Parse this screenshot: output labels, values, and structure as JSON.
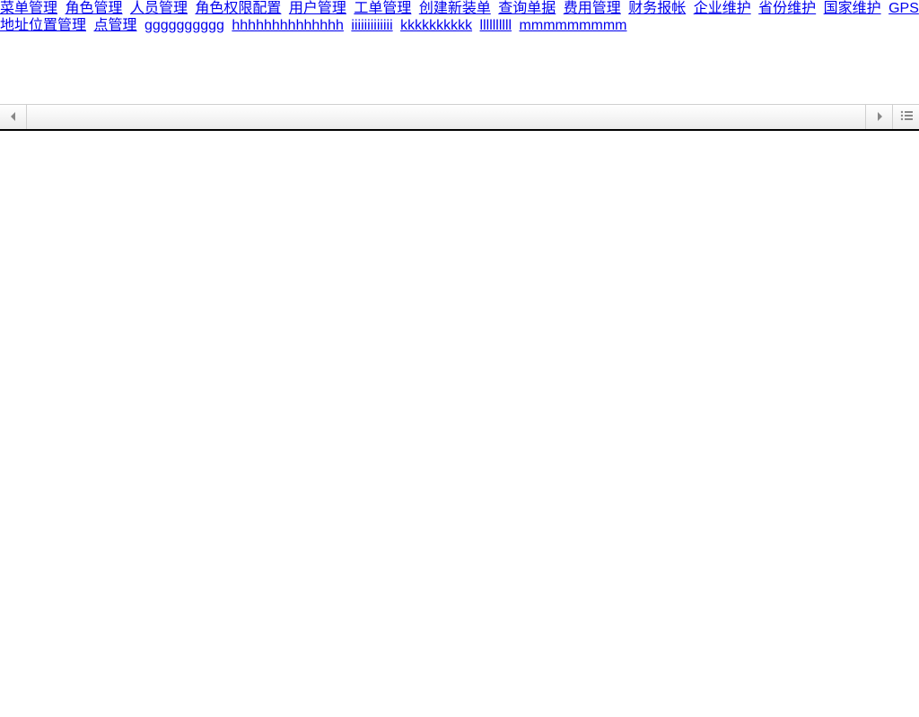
{
  "nav": {
    "items": [
      "菜单管理",
      "角色管理",
      "人员管理",
      "角色权限配置",
      "用户管理",
      "工单管理",
      "创建新装单",
      "查询单据",
      "费用管理",
      "财务报帐",
      "企业维护",
      "省份维护",
      "国家维护",
      "GPS地址位置管理",
      "点管理",
      "gggggggggg",
      "hhhhhhhhhhhhhh",
      "iiiiiiiiiiiii",
      "kkkkkkkkkk",
      "llllllllll",
      "mmmmmmmmm"
    ]
  }
}
